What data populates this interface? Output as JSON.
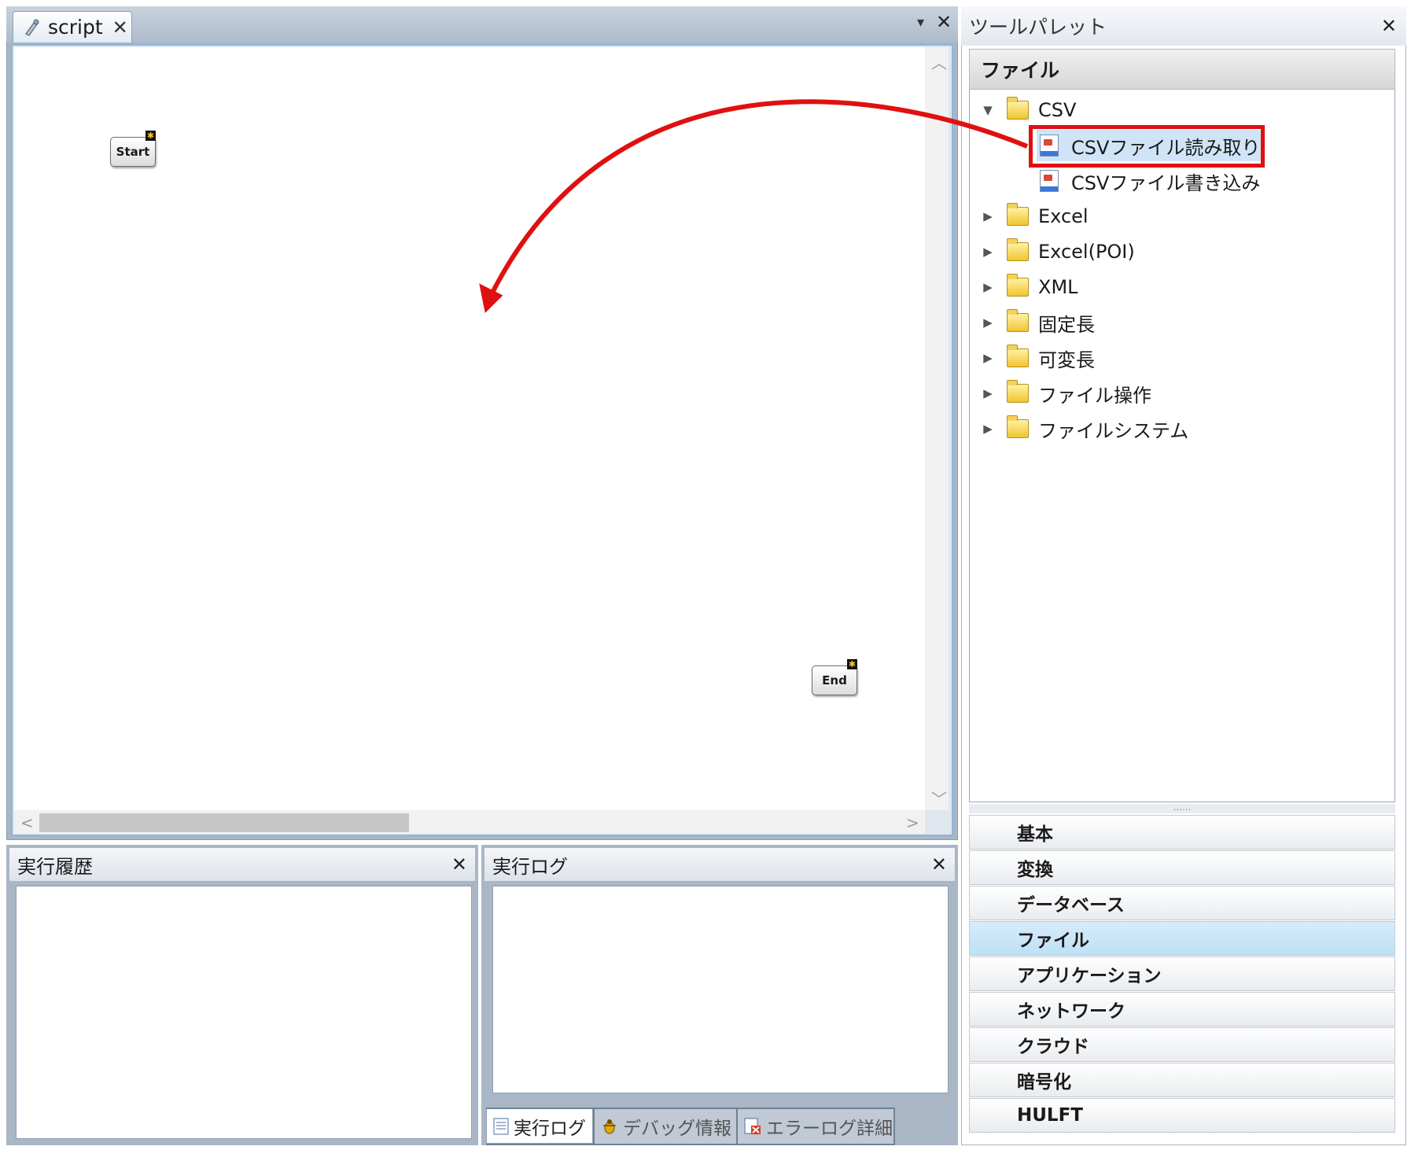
{
  "editor": {
    "tab_label": "script",
    "tab_close": "✕",
    "pin_glyph": "▾",
    "close_glyph": "✕",
    "nodes": {
      "start_label": "Start",
      "end_label": "End",
      "badge": "✱"
    },
    "scroll_left": "<",
    "scroll_right": ">",
    "scroll_up": "︿",
    "scroll_down": "﹀"
  },
  "panels": {
    "history": {
      "title": "実行履歴",
      "close": "✕"
    },
    "log": {
      "title": "実行ログ",
      "close": "✕"
    },
    "bottom_tabs": [
      "実行ログ",
      "デバッグ情報",
      "エラーログ詳細"
    ]
  },
  "palette": {
    "title": "ツールパレット",
    "close": "✕",
    "category_header": "ファイル",
    "tree": [
      {
        "label": "CSV",
        "arrow": "▼",
        "children": [
          "CSVファイル読み取り",
          "CSVファイル書き込み"
        ]
      },
      {
        "label": "Excel",
        "arrow": "▶"
      },
      {
        "label": "Excel(POI)",
        "arrow": "▶"
      },
      {
        "label": "XML",
        "arrow": "▶"
      },
      {
        "label": "固定長",
        "arrow": "▶"
      },
      {
        "label": "可変長",
        "arrow": "▶"
      },
      {
        "label": "ファイル操作",
        "arrow": "▶"
      },
      {
        "label": "ファイルシステム",
        "arrow": "▶"
      }
    ],
    "splitter": "......",
    "categories": [
      "基本",
      "変換",
      "データベース",
      "ファイル",
      "アプリケーション",
      "ネットワーク",
      "クラウド",
      "暗号化",
      "HULFT"
    ],
    "selected_category": "ファイル"
  },
  "colors": {
    "highlight_red": "#e01010",
    "selection_blue": "#cfe4f7"
  }
}
